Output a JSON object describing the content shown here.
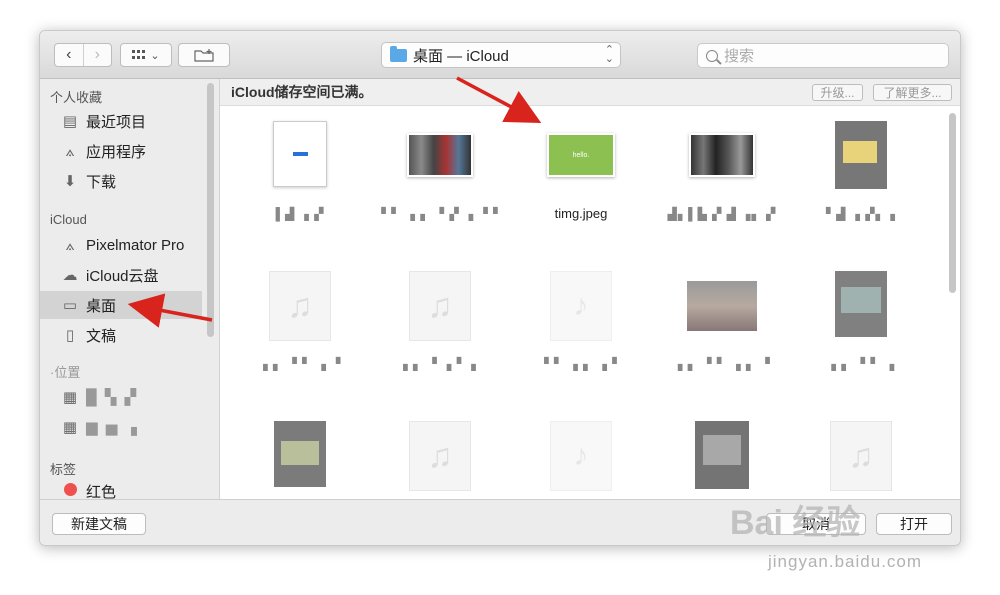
{
  "toolbar": {
    "back_icon": "‹",
    "forward_icon": "›",
    "view_icon": "grid-view-icon",
    "view_chevron": "⌄",
    "location_label": "桌面 — iCloud",
    "search_placeholder": "搜索"
  },
  "sidebar": {
    "favorites_header": "个人收藏",
    "favorites": [
      {
        "label": "最近项目",
        "icon": "▤"
      },
      {
        "label": "应用程序",
        "icon": "⟑"
      },
      {
        "label": "下载",
        "icon": "⬇"
      }
    ],
    "icloud_header": "iCloud",
    "icloud_items": [
      {
        "label": "Pixelmator Pro",
        "icon": "⟑"
      },
      {
        "label": "iCloud云盘",
        "icon": "☁"
      },
      {
        "label": "桌面",
        "icon": "▭"
      },
      {
        "label": "文稿",
        "icon": "▯"
      }
    ],
    "locations_header": "·位置",
    "locations": [
      {
        "label": "█ ▚ ▞",
        "icon": "▦"
      },
      {
        "label": "▆ ▅ ▗",
        "icon": "▦"
      }
    ],
    "tags_header": "标签",
    "tags": [
      {
        "label": "红色",
        "color": "#f0504d"
      }
    ]
  },
  "banner": {
    "text": "iCloud储存空间已满。",
    "upgrade_label": "升级...",
    "learn_more_label": "了解更多..."
  },
  "files": [
    {
      "name": "▌▟ ▗ ▞",
      "blur": true,
      "kind": "doc"
    },
    {
      "name": "▝ ▘ ▗ ▖ ▝ ▞ ▗ ▝ ▘",
      "blur": true,
      "kind": "screenshot"
    },
    {
      "name": "timg.jpeg",
      "blur": false,
      "kind": "green"
    },
    {
      "name": "▟▖▌▙ ▞ ▟ ▗▖ ▞",
      "blur": true,
      "kind": "dark"
    },
    {
      "name": "▘▟ ▗ ▞▖▗",
      "blur": true,
      "kind": "gray-yellow"
    },
    {
      "name": "▗ ▖ ▝ ▘ ▗ ▝",
      "blur": true,
      "kind": "audio"
    },
    {
      "name": "▗ ▖ ▝ ▗ ▘ ▖",
      "blur": true,
      "kind": "audio"
    },
    {
      "name": "▝ ▘ ▗ ▖ ▗ ▘",
      "blur": true,
      "kind": "audio-faint"
    },
    {
      "name": "▗ ▖ ▝ ▘ ▗ ▖ ▝",
      "blur": true,
      "kind": "photo"
    },
    {
      "name": "▗ ▖ ▝ ▘ ▗",
      "blur": true,
      "kind": "gray-photo"
    },
    {
      "name": "",
      "blur": true,
      "kind": "gray-photo2"
    },
    {
      "name": "",
      "blur": true,
      "kind": "audio"
    },
    {
      "name": "",
      "blur": true,
      "kind": "audio-faint"
    },
    {
      "name": "",
      "blur": true,
      "kind": "gray-doc"
    },
    {
      "name": "",
      "blur": true,
      "kind": "audio"
    }
  ],
  "green_thumb_text": "hello.",
  "bottom": {
    "new_doc_label": "新建文稿",
    "cancel_label": "取消",
    "open_label": "打开"
  },
  "watermark": {
    "brand": "Bai 经验",
    "url": "jingyan.baidu.com"
  },
  "colors": {
    "arrow": "#d9231d",
    "accent_folder": "#5aa9e6",
    "green_thumb": "#8cc152"
  }
}
